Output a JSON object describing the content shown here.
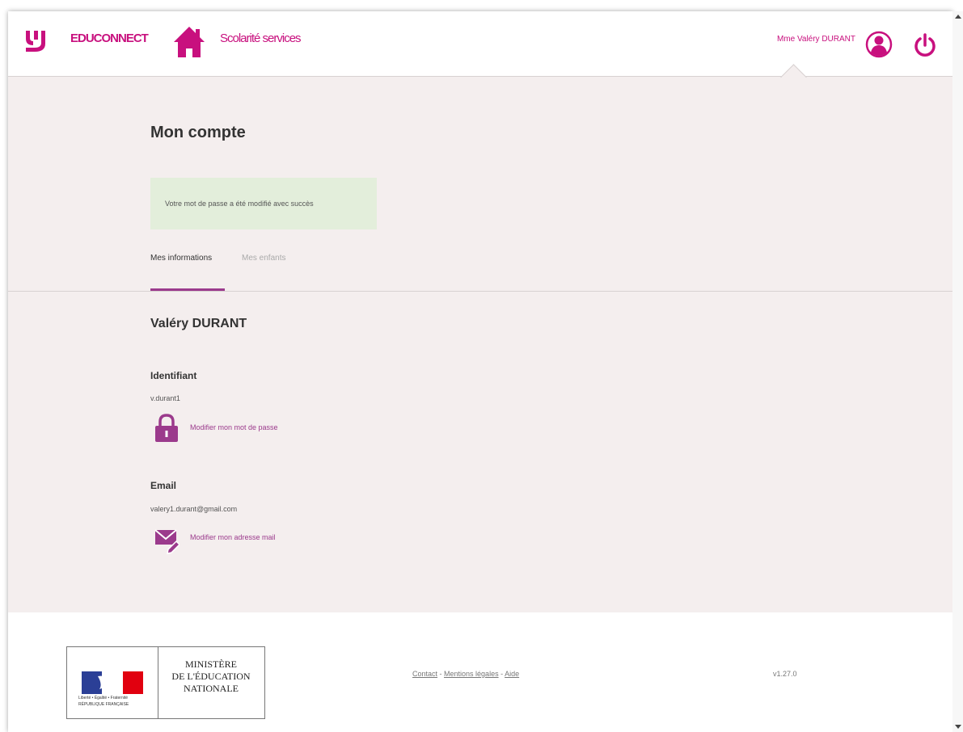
{
  "header": {
    "brand": "EDUCONNECT",
    "services": "Scolarité services",
    "user_name": "Mme Valéry DURANT"
  },
  "page": {
    "title": "Mon compte",
    "alert": "Votre mot de passe a été modifié avec succès"
  },
  "tabs": [
    {
      "label": "Mes informations",
      "active": true
    },
    {
      "label": "Mes enfants",
      "active": false
    }
  ],
  "profile": {
    "full_name": "Valéry DURANT",
    "identifier_label": "Identifiant",
    "identifier_value": "v.durant1",
    "change_password": "Modifier mon mot de passe",
    "email_label": "Email",
    "email_value": "valery1.durant@gmail.com",
    "change_email": "Modifier mon adresse mail"
  },
  "footer": {
    "ministry_line1": "MINISTÈRE",
    "ministry_line2": "DE L'ÉDUCATION",
    "ministry_line3": "NATIONALE",
    "republic_motto": "Liberté • Égalité • Fraternité",
    "republic_name": "RÉPUBLIQUE FRANÇAISE",
    "links": [
      "Contact",
      "Mentions légales",
      "Aide"
    ],
    "link_separator": " - ",
    "version": "v1.27.0"
  },
  "colors": {
    "accent": "#c8107e",
    "tab_underline": "#9b3a8c",
    "page_background": "#f4eeee",
    "alert_background": "#e3eedb"
  },
  "icons": [
    "educonnect-logo-icon",
    "home-icon",
    "user-avatar-icon",
    "power-icon",
    "lock-icon",
    "mail-edit-icon"
  ]
}
